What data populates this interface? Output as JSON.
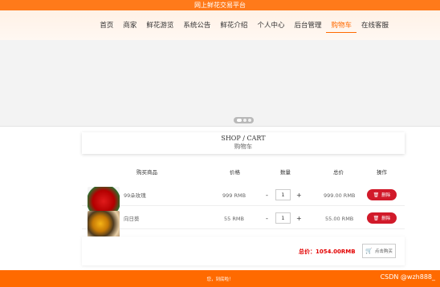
{
  "site": {
    "title": "网上鲜花交易平台"
  },
  "nav": {
    "items": [
      "首页",
      "商家",
      "鲜花游览",
      "系统公告",
      "鲜花介绍",
      "个人中心",
      "后台管理",
      "购物车",
      "在线客服"
    ],
    "active_index": 7
  },
  "section": {
    "title_en": "SHOP / CART",
    "title_cn": "购物车"
  },
  "table": {
    "headers": [
      "购买商品",
      "价格",
      "数量",
      "总价",
      "操作"
    ],
    "rows": [
      {
        "name": "99朵玫瑰",
        "price": "999 RMB",
        "qty": "1",
        "total": "999.00 RMB",
        "delete_label": "删除",
        "image": "rose-bouquet"
      },
      {
        "name": "向日葵",
        "price": "55 RMB",
        "qty": "1",
        "total": "55.00 RMB",
        "delete_label": "删除",
        "image": "sunflower-bouquet"
      }
    ],
    "minus": "-",
    "plus": "+"
  },
  "summary": {
    "total": "总价：1054.00RMB",
    "checkout_label": "点击购买"
  },
  "footer": {
    "text": "您，到底啦！"
  },
  "watermark": "CSDN @wzh888_",
  "icons": {
    "delete": "trash-icon",
    "checkout": "cart-icon"
  },
  "colors": {
    "accent": "#ff6a00",
    "delete": "#d11a2a",
    "total": "#e30000"
  }
}
